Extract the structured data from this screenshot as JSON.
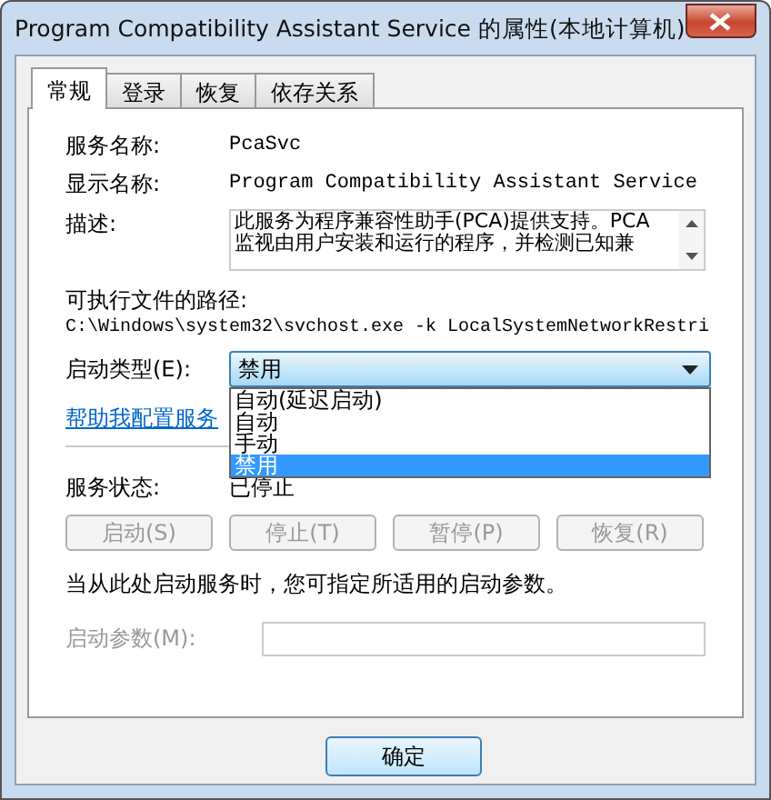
{
  "window": {
    "title": "Program Compatibility Assistant Service 的属性(本地计算机)"
  },
  "tabs": [
    {
      "label": "常规",
      "selected": true
    },
    {
      "label": "登录",
      "selected": false
    },
    {
      "label": "恢复",
      "selected": false
    },
    {
      "label": "依存关系",
      "selected": false
    }
  ],
  "fields": [
    {
      "label": "服务名称:",
      "value": "PcaSvc"
    },
    {
      "label": "显示名称:",
      "value": "Program Compatibility Assistant Service"
    }
  ],
  "description": {
    "label": "描述:",
    "lines": [
      "此服务为程序兼容性助手(PCA)提供支持。PCA",
      "监视由用户安装和运行的程序，并检测已知兼"
    ]
  },
  "path": {
    "label": "可执行文件的路径:",
    "value": "C:\\Windows\\system32\\svchost.exe -k LocalSystemNetworkRestri"
  },
  "startup_type": {
    "label": "启动类型(E):",
    "value": "禁用",
    "expanded": true,
    "options": [
      {
        "label": "自动(延迟启动)",
        "selected": false
      },
      {
        "label": "自动",
        "selected": false
      },
      {
        "label": "手动",
        "selected": false
      },
      {
        "label": "禁用",
        "selected": true
      }
    ]
  },
  "help_link": "帮助我配置服务",
  "service_status": {
    "label": "服务状态:",
    "value": "已停止"
  },
  "service_buttons": [
    {
      "label": "启动(S)",
      "disabled": true
    },
    {
      "label": "停止(T)",
      "disabled": true
    },
    {
      "label": "暂停(P)",
      "disabled": true
    },
    {
      "label": "恢复(R)",
      "disabled": true
    }
  ],
  "hint": "当从此处启动服务时，您可指定所适用的启动参数。",
  "start_parameters": {
    "label": "启动参数(M):",
    "disabled": true
  },
  "buttons": [
    {
      "label": "确定"
    }
  ]
}
